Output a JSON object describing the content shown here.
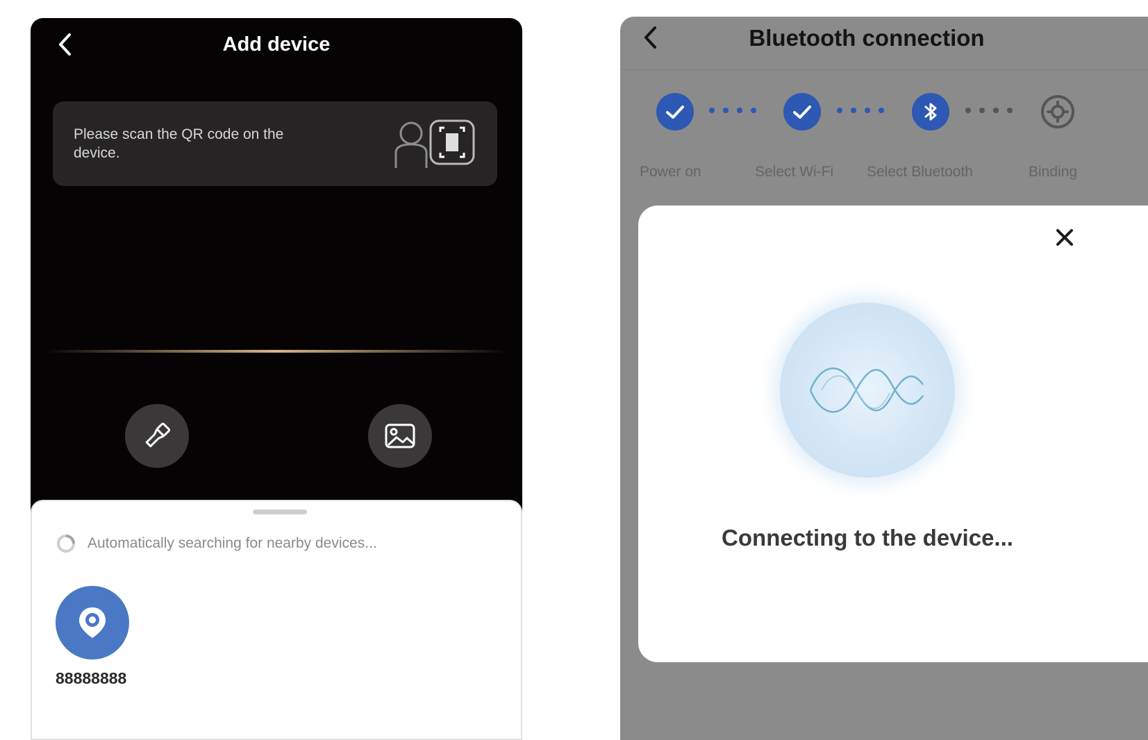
{
  "add_device": {
    "title": "Add device",
    "scan_prompt": "Please scan the QR code on the device.",
    "search_status": "Automatically searching for nearby devices...",
    "device": {
      "name": "88888888"
    }
  },
  "bluetooth": {
    "title": "Bluetooth connection",
    "steps": [
      {
        "label": "Power on",
        "state": "done"
      },
      {
        "label": "Select Wi-Fi",
        "state": "done"
      },
      {
        "label": "Select Bluetooth",
        "state": "current"
      },
      {
        "label": "Binding",
        "state": "pending"
      }
    ],
    "status": "Connecting to the device..."
  },
  "colors": {
    "left_background": "#060304",
    "accent_blue": "#2d58b3",
    "device_avatar": "#4a78c4",
    "overlay_grey": "#8b8b8b"
  },
  "icons": [
    "chevron-left-icon",
    "scan-person-icon",
    "scan-frame-icon",
    "flashlight-icon",
    "image-icon",
    "search-spinner-icon",
    "location-pin-icon",
    "check-icon",
    "bluetooth-icon",
    "binding-gear-icon",
    "close-icon",
    "connection-wave-icon"
  ]
}
